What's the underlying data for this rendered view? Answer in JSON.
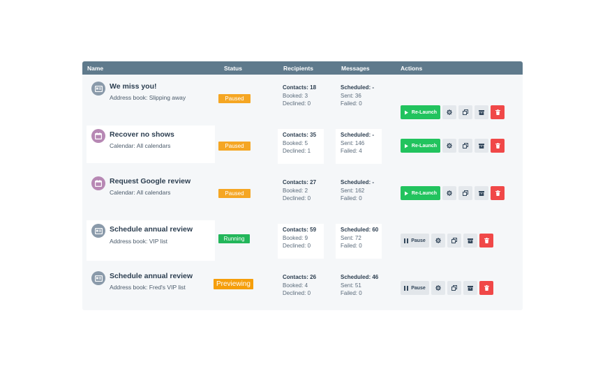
{
  "columns": {
    "name": "Name",
    "status": "Status",
    "recipients": "Recipients",
    "messages": "Messages",
    "actions": "Actions"
  },
  "colors": {
    "header": "#5f7a8c",
    "paused": "#f5a623",
    "running": "#22b65a",
    "relaunch": "#22c35e",
    "delete": "#f04848"
  },
  "campaigns": [
    {
      "icon": "address-book-icon",
      "title": "We miss you!",
      "source": "Address book: Slipping away",
      "status": "Paused",
      "contacts": "Contacts: 18",
      "booked": "Booked: 3",
      "declined": "Declined: 0",
      "scheduled": "Scheduled: -",
      "sent": "Sent: 36",
      "failed": "Failed: 0",
      "primary_action": "Re-Launch"
    },
    {
      "icon": "calendar-icon",
      "title": "Recover no shows",
      "source": "Calendar: All calendars",
      "status": "Paused",
      "contacts": "Contacts: 35",
      "booked": "Booked: 5",
      "declined": "Declined: 1",
      "scheduled": "Scheduled: -",
      "sent": "Sent: 146",
      "failed": "Failed: 4",
      "primary_action": "Re-Launch"
    },
    {
      "icon": "calendar-icon",
      "title": "Request Google review",
      "source": "Calendar: All calendars",
      "status": "Paused",
      "contacts": "Contacts: 27",
      "booked": "Booked: 2",
      "declined": "Declined: 0",
      "scheduled": "Scheduled: -",
      "sent": "Sent: 162",
      "failed": "Failed: 0",
      "primary_action": "Re-Launch"
    },
    {
      "icon": "address-book-icon",
      "title": "Schedule annual review",
      "source": "Address book: VIP list",
      "status": "Running",
      "contacts": "Contacts: 59",
      "booked": "Booked: 9",
      "declined": "Declined: 0",
      "scheduled": "Scheduled: 60",
      "sent": "Sent: 72",
      "failed": "Failed: 0",
      "primary_action": "Pause"
    },
    {
      "icon": "address-book-icon",
      "title": "Schedule annual review",
      "source": "Address book: Fred's VIP list",
      "status": "Previewing",
      "contacts": "Contacts: 26",
      "booked": "Booked: 4",
      "declined": "Declined: 0",
      "scheduled": "Scheduled: 46",
      "sent": "Sent: 51",
      "failed": "Failed: 0",
      "primary_action": "Pause"
    }
  ]
}
